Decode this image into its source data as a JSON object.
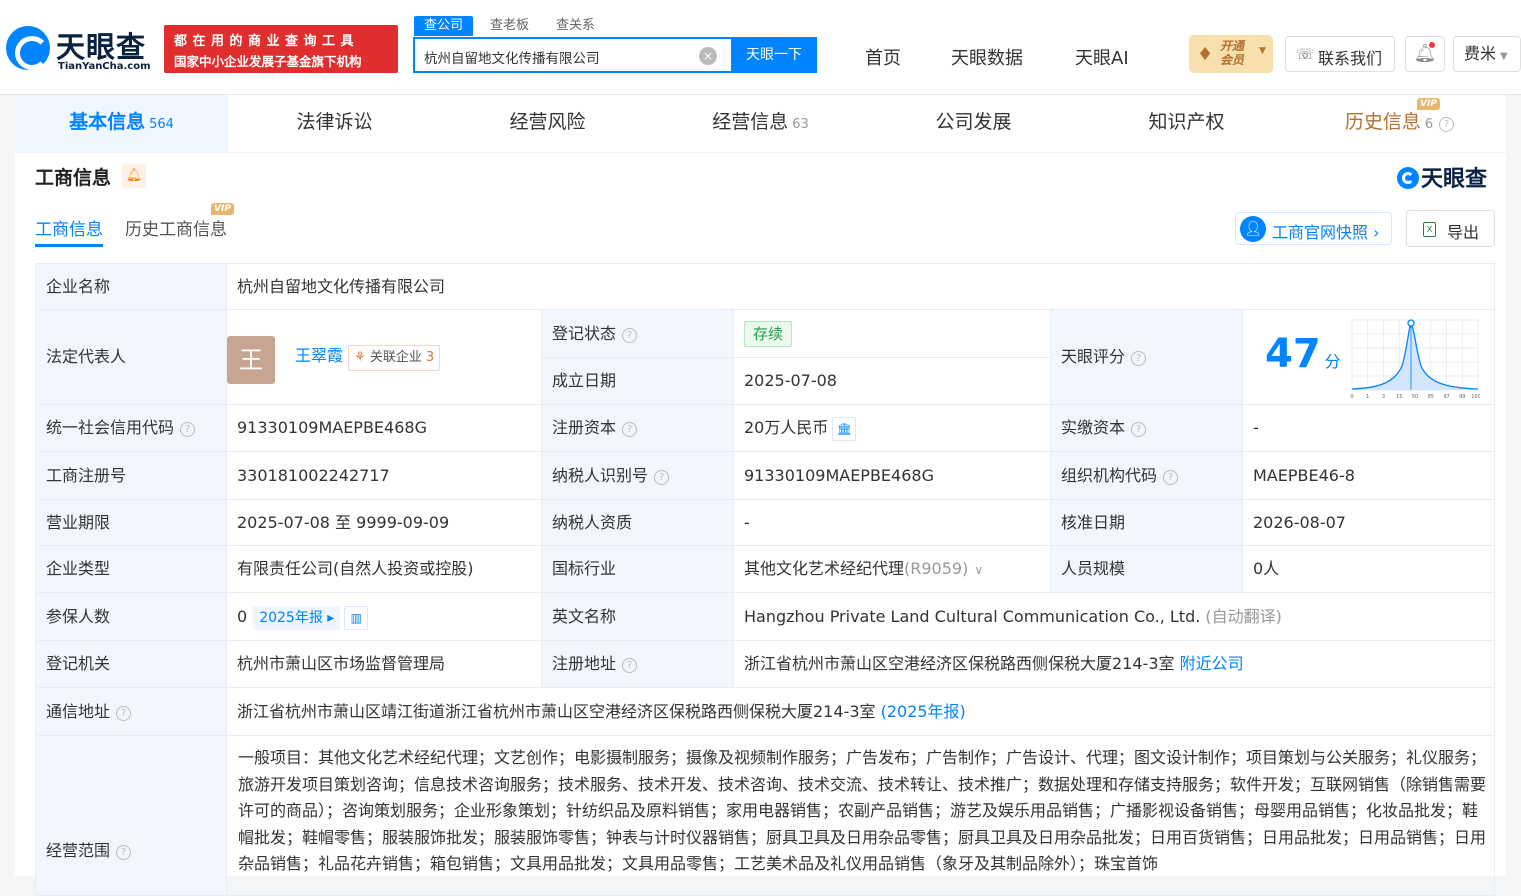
{
  "header": {
    "logo_title": "天眼查",
    "logo_sub": "TianYanCha.com",
    "banner_line1": "都在用的商业查询工具",
    "banner_line2": "国家中小企业发展子基金旗下机构",
    "search_tabs": [
      "查公司",
      "查老板",
      "查关系"
    ],
    "search_value": "杭州自留地文化传播有限公司",
    "search_button": "天眼一下",
    "nav": [
      "首页",
      "天眼数据",
      "天眼AI"
    ],
    "vip_line1": "开通",
    "vip_line2": "会员",
    "contact": "联系我们",
    "user": "费米"
  },
  "tabs": [
    {
      "label": "基本信息",
      "count": "564"
    },
    {
      "label": "法律诉讼",
      "count": ""
    },
    {
      "label": "经营风险",
      "count": ""
    },
    {
      "label": "经营信息",
      "count": "63"
    },
    {
      "label": "公司发展",
      "count": ""
    },
    {
      "label": "知识产权",
      "count": ""
    },
    {
      "label": "历史信息",
      "count": "6"
    }
  ],
  "vip_badge": "VIP",
  "section": {
    "title": "工商信息",
    "watermark": "天眼查",
    "subtabs": [
      "工商信息",
      "历史工商信息"
    ],
    "snapshot_button": "工商官网快照",
    "export_button": "导出"
  },
  "info": {
    "company_name_label": "企业名称",
    "company_name": "杭州自留地文化传播有限公司",
    "legal_rep_label": "法定代表人",
    "legal_rep_avatar": "王",
    "legal_rep_name": "王翠霞",
    "related_label": "关联企业",
    "related_count": "3",
    "reg_status_label": "登记状态",
    "reg_status": "存续",
    "established_label": "成立日期",
    "established": "2025-07-08",
    "score_label": "天眼评分",
    "score": "47",
    "score_unit": "分",
    "score_axis": [
      "0",
      "1",
      "3",
      "15",
      "50",
      "85",
      "97",
      "99",
      "100"
    ],
    "credit_code_label": "统一社会信用代码",
    "credit_code": "91330109MAEPBE468G",
    "reg_capital_label": "注册资本",
    "reg_capital": "20万人民币",
    "paid_capital_label": "实缴资本",
    "paid_capital": "-",
    "reg_no_label": "工商注册号",
    "reg_no": "330181002242717",
    "taxpayer_id_label": "纳税人识别号",
    "taxpayer_id": "91330109MAEPBE468G",
    "org_code_label": "组织机构代码",
    "org_code": "MAEPBE46-8",
    "term_label": "营业期限",
    "term": "2025-07-08 至 9999-09-09",
    "taxpayer_qual_label": "纳税人资质",
    "taxpayer_qual": "-",
    "approval_date_label": "核准日期",
    "approval_date": "2026-08-07",
    "type_label": "企业类型",
    "type": "有限责任公司(自然人投资或控股)",
    "industry_label": "国标行业",
    "industry": "其他文化艺术经纪代理",
    "industry_code": "(R9059)",
    "staff_label": "人员规模",
    "staff": "0人",
    "insured_label": "参保人数",
    "insured": "0",
    "insured_report": "2025年报",
    "english_label": "英文名称",
    "english": "Hangzhou Private Land Cultural Communication Co., Ltd.",
    "english_note": "(自动翻译)",
    "authority_label": "登记机关",
    "authority": "杭州市萧山区市场监督管理局",
    "reg_addr_label": "注册地址",
    "reg_addr": "浙江省杭州市萧山区空港经济区保税路西侧保税大厦214-3室",
    "nearby": "附近公司",
    "mail_addr_label": "通信地址",
    "mail_addr": "浙江省杭州市萧山区靖江街道浙江省杭州市萧山区空港经济区保税路西侧保税大厦214-3室",
    "mail_report": "(2025年报)",
    "scope_label": "经营范围",
    "scope": "一般项目：其他文化艺术经纪代理；文艺创作；电影摄制服务；摄像及视频制作服务；广告发布；广告制作；广告设计、代理；图文设计制作；项目策划与公关服务；礼仪服务；旅游开发项目策划咨询；信息技术咨询服务；技术服务、技术开发、技术咨询、技术交流、技术转让、技术推广；数据处理和存储支持服务；软件开发；互联网销售（除销售需要许可的商品）；咨询策划服务；企业形象策划；针纺织品及原料销售；家用电器销售；农副产品销售；游艺及娱乐用品销售；广播影视设备销售；母婴用品销售；化妆品批发；鞋帽批发；鞋帽零售；服装服饰批发；服装服饰零售；钟表与计时仪器销售；厨具卫具及日用杂品零售；厨具卫具及日用杂品批发；日用百货销售；日用品批发；日用品销售；日用杂品销售；礼品花卉销售；箱包销售；文具用品批发；文具用品零售；工艺美术品及礼仪用品销售（象牙及其制品除外）；珠宝首饰"
  }
}
